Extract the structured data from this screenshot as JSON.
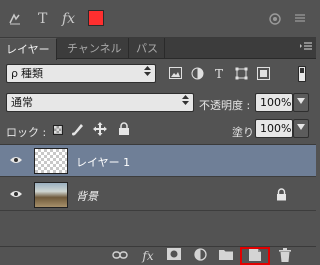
{
  "top_toolbar": {
    "icons": [
      "warp-text-icon",
      "type-icon",
      "fx-icon"
    ],
    "type_glyph": "T",
    "fx_glyph": "fx",
    "color_swatch": "#ff2f2f"
  },
  "panel": {
    "tabs": [
      {
        "label": "レイヤー",
        "active": true
      },
      {
        "label": "チャンネル",
        "active": false
      },
      {
        "label": "パス",
        "active": false
      }
    ],
    "filter": {
      "kind_label": "種類",
      "kind_glyph": "ρ",
      "icons": [
        "pixel-filter-icon",
        "adjustment-filter-icon",
        "type-filter-icon",
        "shape-filter-icon",
        "smart-object-filter-icon"
      ],
      "type_glyph": "T"
    },
    "blend": {
      "mode": "通常",
      "opacity_label": "不透明度 :",
      "opacity_value": "100%"
    },
    "lock": {
      "label": "ロック :",
      "fill_label": "塗り :",
      "fill_value": "100%"
    },
    "layers": [
      {
        "name": "レイヤー 1",
        "selected": true,
        "visible": true,
        "thumbnail": "transparent",
        "locked": false
      },
      {
        "name": "背景",
        "selected": false,
        "visible": true,
        "thumbnail": "photo",
        "locked": true
      }
    ],
    "bottom_icons": [
      "link-layers-icon",
      "fx-icon",
      "add-mask-icon",
      "adjustment-layer-icon",
      "new-group-icon",
      "new-layer-icon",
      "delete-layer-icon"
    ],
    "fx_glyph": "fx",
    "highlighted_icon": "new-layer-icon"
  },
  "colors": {
    "panel_bg": "#535353",
    "selected_layer": "#6f7f97",
    "highlight": "#e10000"
  }
}
